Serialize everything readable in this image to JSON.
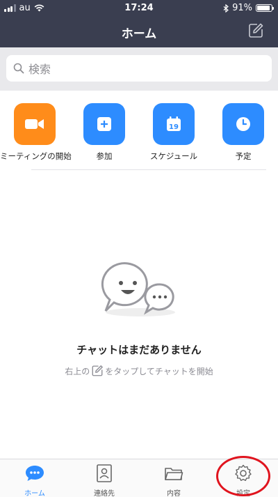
{
  "status_bar": {
    "carrier": "au",
    "time": "17:24",
    "battery_text": "91%",
    "battery_level": 0.91
  },
  "header": {
    "title": "ホーム",
    "compose_icon": "compose-icon"
  },
  "search": {
    "placeholder": "検索"
  },
  "actions": [
    {
      "label": "ミーティングの開始",
      "icon": "video-camera-icon",
      "color": "#ff8c1a"
    },
    {
      "label": "参加",
      "icon": "plus-square-icon",
      "color": "#2d8cff"
    },
    {
      "label": "スケジュール",
      "icon": "calendar-icon",
      "color": "#2d8cff",
      "calendar_day": "19"
    },
    {
      "label": "予定",
      "icon": "clock-icon",
      "color": "#2d8cff"
    }
  ],
  "empty_state": {
    "title": "チャットはまだありません",
    "hint_before": "右上の",
    "hint_after": "をタップしてチャットを開始"
  },
  "tabs": [
    {
      "label": "ホーム",
      "icon": "chat-bubble-icon",
      "active": true
    },
    {
      "label": "連絡先",
      "icon": "contacts-icon",
      "active": false
    },
    {
      "label": "内容",
      "icon": "folder-icon",
      "active": false
    },
    {
      "label": "設定",
      "icon": "gear-icon",
      "active": false
    }
  ],
  "colors": {
    "header_bg": "#3a3e50",
    "accent_blue": "#2d8cff",
    "accent_orange": "#ff8c1a",
    "highlight_red": "#e0141e"
  }
}
